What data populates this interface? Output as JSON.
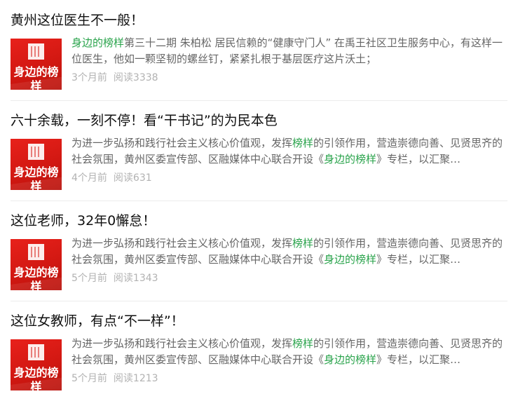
{
  "colors": {
    "title": "#111111",
    "summary": "#666666",
    "meta": "#b2b2b2",
    "highlight": "#29a34b",
    "thumb_red": "#d21812"
  },
  "articles": [
    {
      "title": "黄州这位医生不一般！",
      "thumb_text": "身边的榜样",
      "summary_parts": [
        {
          "text": "身边的榜样",
          "highlight": true
        },
        {
          "text": "第三十二期 朱柏松 居民信赖的“健康守门人” 在禹王社区卫生服务中心，有这样一位医生，他如一颗坚韧的螺丝钉，紧紧扎根于基层医疗这片沃土；",
          "highlight": false
        }
      ],
      "time": "3个月前",
      "reads": "阅读3338"
    },
    {
      "title": "六十余载，一刻不停！看“干书记”的为民本色",
      "thumb_text": "身边的榜样",
      "summary_parts": [
        {
          "text": "为进一步弘扬和践行社会主义核心价值观，发挥",
          "highlight": false
        },
        {
          "text": "榜样",
          "highlight": true
        },
        {
          "text": "的引领作用，营造崇德向善、见贤思齐的社会氛围，黄州区委宣传部、区融媒体中心联合开设《",
          "highlight": false
        },
        {
          "text": "身边的榜样",
          "highlight": true
        },
        {
          "text": "》专栏，以汇聚…",
          "highlight": false
        }
      ],
      "time": "4个月前",
      "reads": "阅读631"
    },
    {
      "title": "这位老师，32年0懈怠！",
      "thumb_text": "身边的榜样",
      "summary_parts": [
        {
          "text": "为进一步弘扬和践行社会主义核心价值观，发挥",
          "highlight": false
        },
        {
          "text": "榜样",
          "highlight": true
        },
        {
          "text": "的引领作用，营造崇德向善、见贤思齐的社会氛围，黄州区委宣传部、区融媒体中心联合开设《",
          "highlight": false
        },
        {
          "text": "身边的榜样",
          "highlight": true
        },
        {
          "text": "》专栏，以汇聚…",
          "highlight": false
        }
      ],
      "time": "5个月前",
      "reads": "阅读1343"
    },
    {
      "title": "这位女教师，有点“不一样”！",
      "thumb_text": "身边的榜样",
      "summary_parts": [
        {
          "text": "为进一步弘扬和践行社会主义核心价值观，发挥",
          "highlight": false
        },
        {
          "text": "榜样",
          "highlight": true
        },
        {
          "text": "的引领作用，营造崇德向善、见贤思齐的社会氛围，黄州区委宣传部、区融媒体中心联合开设《",
          "highlight": false
        },
        {
          "text": "身边的榜样",
          "highlight": true
        },
        {
          "text": "》专栏，以汇聚…",
          "highlight": false
        }
      ],
      "time": "5个月前",
      "reads": "阅读1213"
    }
  ]
}
